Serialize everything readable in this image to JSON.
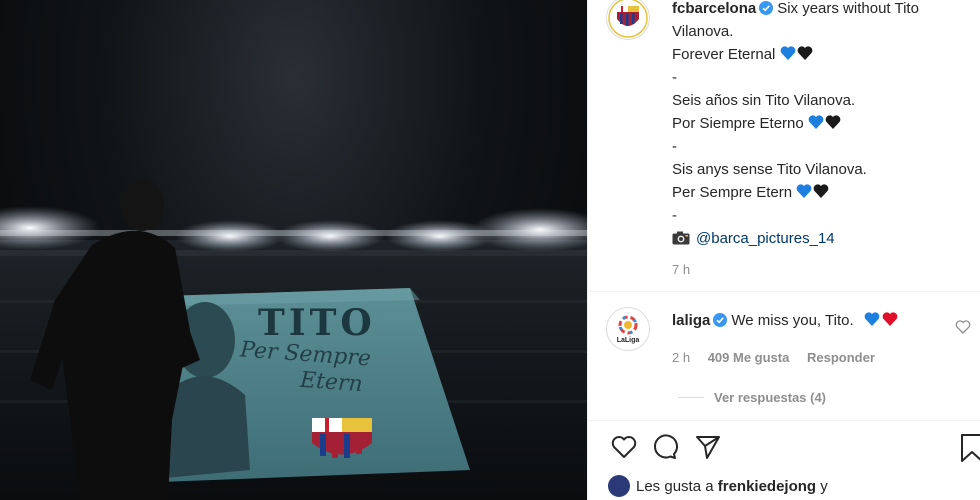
{
  "post": {
    "banner": {
      "title": "TITO",
      "line1": "Per Sempre",
      "line2": "Etern"
    },
    "author": "fcbarcelona",
    "caption_lines": [
      "Six years without Tito",
      "Vilanova.",
      "Forever Eternal",
      "-",
      "Seis años sin Tito Vilanova.",
      "Por Siempre Eterno",
      "-",
      "Sis anys sense Tito Vilanova.",
      "Per Sempre Etern",
      "-"
    ],
    "photo_credit": "@barca_pictures_14",
    "time_ago": "7 h"
  },
  "comment": {
    "user": "laliga",
    "text": "We miss you, Tito.",
    "time": "2 h",
    "likes": "409 Me gusta",
    "reply_label": "Responder",
    "view_replies": "Ver respuestas (4)",
    "avatar_text": "LaLiga"
  },
  "likes_line": {
    "prefix": "Les gusta a",
    "user": "frenkiedejong",
    "suffix": "y"
  },
  "icons": {
    "verified": "verified-badge-icon",
    "blue_heart": "blue-heart-emoji",
    "black_heart": "black-heart-emoji",
    "red_heart": "red-heart-emoji",
    "camera": "camera-emoji",
    "like": "heart-outline-icon",
    "comment": "comment-bubble-icon",
    "share": "paper-plane-icon",
    "save": "bookmark-icon"
  },
  "colors": {
    "verified": "#3897f0",
    "blue_heart": "#1d7fe0",
    "red_heart": "#e0102a",
    "mention": "#00376b",
    "muted": "#8e8e8e"
  }
}
